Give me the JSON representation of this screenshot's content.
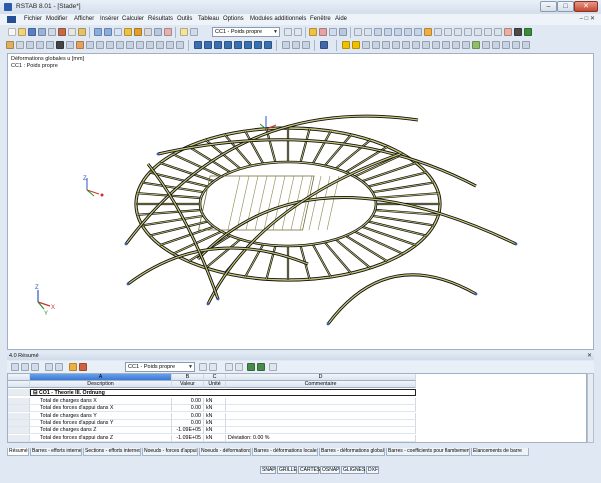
{
  "window": {
    "title": "RSTAB 8.01 - [Stade*]",
    "minimize": "–",
    "maximize": "□",
    "close": "✕"
  },
  "menu": {
    "items": [
      "Fichier",
      "Modifier",
      "Afficher",
      "Insérer",
      "Calculer",
      "Résultats",
      "Outils",
      "Tableau",
      "Options",
      "Modules additionnels",
      "Fenêtre",
      "Aide"
    ],
    "mdi_controls": "– □ ✕"
  },
  "toolbar": {
    "load_case": "CC1 - Poids propre"
  },
  "viewport": {
    "result_label": "Déformations globales u [mm]",
    "case_label": "CC1 : Poids propre",
    "axis_x": "X",
    "axis_y": "Y",
    "axis_z": "Z",
    "axis_colors": {
      "x": "#d42b2b",
      "y": "#2a8f2a",
      "z": "#2e54c8"
    },
    "structure_fill": "#c8c87a",
    "structure_stroke": "#101010"
  },
  "panel": {
    "title": "4.0 Résumé",
    "close": "✕",
    "load_case": "CC1 - Poids propre",
    "column_letters": [
      "A",
      "B",
      "C",
      "D"
    ],
    "headers": [
      "Description",
      "Valeur",
      "Unité",
      "Commentaire"
    ],
    "group_label": "CO1 - Theorie III. Ordnung",
    "rows": [
      {
        "description": "Total de charges dans X",
        "value": "0.00",
        "unit": "kN",
        "comment": ""
      },
      {
        "description": "Total des forces d'appui dans X",
        "value": "0.00",
        "unit": "kN",
        "comment": ""
      },
      {
        "description": "Total de charges dans Y",
        "value": "0.00",
        "unit": "kN",
        "comment": ""
      },
      {
        "description": "Total des forces d'appui dans Y",
        "value": "0.00",
        "unit": "kN",
        "comment": ""
      },
      {
        "description": "Total de charges dans Z",
        "value": "-1.09E+05",
        "unit": "kN",
        "comment": ""
      },
      {
        "description": "Total des forces d'appui dans Z",
        "value": "-1.09E+05",
        "unit": "kN",
        "comment": "Déviation:  0.00 %"
      }
    ]
  },
  "tabs": [
    "Résumé",
    "Barres - efforts internes",
    "Sections - efforts internes",
    "Noeuds - forces d'appui",
    "Noeuds - déformations",
    "Barres - déformations locales",
    "Barres - déformations globales",
    "Barres - coefficients pour flambement",
    "Élancements de barre"
  ],
  "status_buttons": [
    "SNAP",
    "GRILLE",
    "CARTES",
    "OSNAP",
    "GLIGNES",
    "DXF"
  ]
}
